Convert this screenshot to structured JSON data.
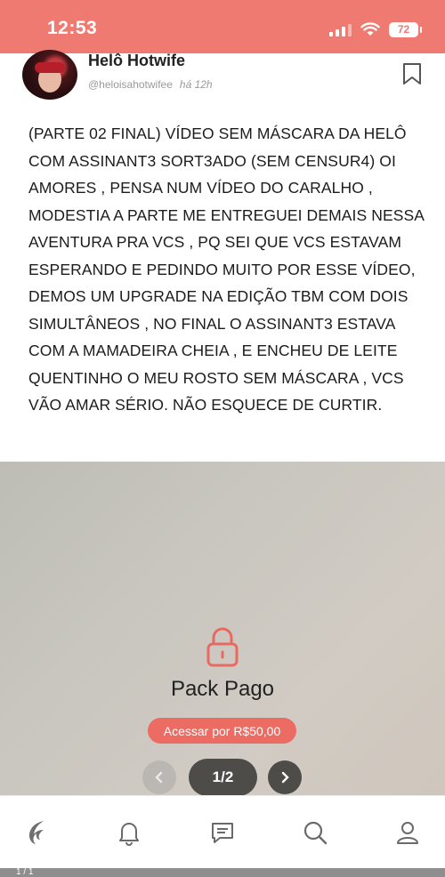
{
  "status_bar": {
    "time": "12:53",
    "battery": "72"
  },
  "post": {
    "author_name": "Helô Hotwife",
    "author_handle": "@heloisahotwifee",
    "time_ago": "há 12h",
    "text": "(PARTE 02 FINAL) VÍDEO SEM MÁSCARA DA HELÔ COM ASSINANT3 SORT3ADO (SEM CENSUR4) OI AMORES , PENSA NUM VÍDEO DO CARALHO , MODESTIA A PARTE ME ENTREGUEI DEMAIS NESSA AVENTURA PRA VCS , PQ SEI QUE VCS ESTAVAM ESPERANDO E PEDINDO MUITO POR ESSE VÍDEO, DEMOS UM UPGRADE NA EDIÇÃO TBM COM DOIS SIMULTÂNEOS , NO FINAL O ASSINANT3 ESTAVA COM A MAMADEIRA CHEIA , E ENCHEU DE LEITE QUENTINHO O MEU ROSTO SEM MÁSCARA , VCS VÃO AMAR SÉRIO. NÃO ESQUECE DE CURTIR."
  },
  "media": {
    "lock_title": "Pack Pago",
    "buy_label": "Acessar por R$50,00",
    "page_indicator": "1/2"
  },
  "bottom_strip": {
    "text": "1 / 1"
  },
  "colors": {
    "accent": "#ee7a72",
    "button": "#ec6b63",
    "pager": "#4d4c49"
  },
  "icons": [
    "signal-icon",
    "wifi-icon",
    "battery-icon",
    "bookmark-icon",
    "lock-icon",
    "chevron-left-icon",
    "chevron-right-icon",
    "home-flame-icon",
    "bell-icon",
    "messages-icon",
    "search-icon",
    "profile-icon"
  ]
}
